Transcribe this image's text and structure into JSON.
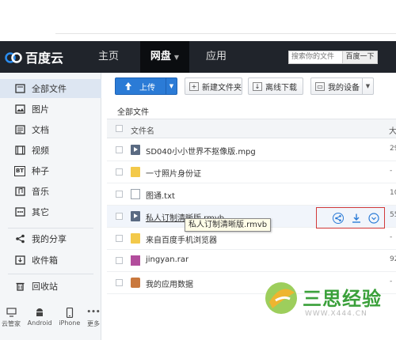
{
  "app": {
    "logo_text": "百度云"
  },
  "nav": {
    "items": [
      "主页",
      "网盘",
      "应用"
    ],
    "active": "网盘"
  },
  "search": {
    "placeholder": "搜索你的文件",
    "button": "百度一下"
  },
  "sidebar": {
    "items": [
      {
        "label": "全部文件",
        "icon": "folder-icon",
        "active": true
      },
      {
        "label": "图片",
        "icon": "image-icon"
      },
      {
        "label": "文档",
        "icon": "document-icon"
      },
      {
        "label": "视频",
        "icon": "video-icon"
      },
      {
        "label": "种子",
        "icon": "torrent-icon",
        "icon_text": "BT"
      },
      {
        "label": "音乐",
        "icon": "music-icon"
      },
      {
        "label": "其它",
        "icon": "more-icon"
      },
      {
        "label": "我的分享",
        "icon": "share-icon"
      },
      {
        "label": "收件箱",
        "icon": "inbox-icon"
      },
      {
        "label": "回收站",
        "icon": "trash-icon"
      }
    ],
    "devices": [
      "云管家",
      "Android",
      "iPhone",
      "更多"
    ]
  },
  "toolbar": {
    "upload": "上传",
    "new_folder": "新建文件夹",
    "offline_download": "离线下载",
    "my_devices": "我的设备"
  },
  "breadcrumb": "全部文件",
  "table": {
    "col_name": "文件名",
    "col_size": "大",
    "rows": [
      {
        "name": "SD040小小世界不抠像版.mpg",
        "type": "video",
        "size": "29"
      },
      {
        "name": "一寸照片身份证",
        "type": "folder",
        "size": "-"
      },
      {
        "name": "图通.txt",
        "type": "txt",
        "size": "10"
      },
      {
        "name": "私人订制清晰版.rmvb",
        "type": "video",
        "size": "55",
        "hover": true
      },
      {
        "name": "来自百度手机浏览器",
        "type": "folder",
        "size": "-"
      },
      {
        "name": "jingyan.rar",
        "type": "rar",
        "size": "92"
      },
      {
        "name": "我的应用数据",
        "type": "app",
        "size": "-"
      }
    ]
  },
  "row_actions": [
    "share-icon",
    "download-icon",
    "more-icon"
  ],
  "tooltip": "私人订制清晰版.rmvb",
  "watermark": {
    "text": "三思经验",
    "url": "WWW.X444.CN"
  },
  "colors": {
    "header": "#20242b",
    "accent": "#2b7bd6",
    "highlight_box": "#d23a3a"
  }
}
